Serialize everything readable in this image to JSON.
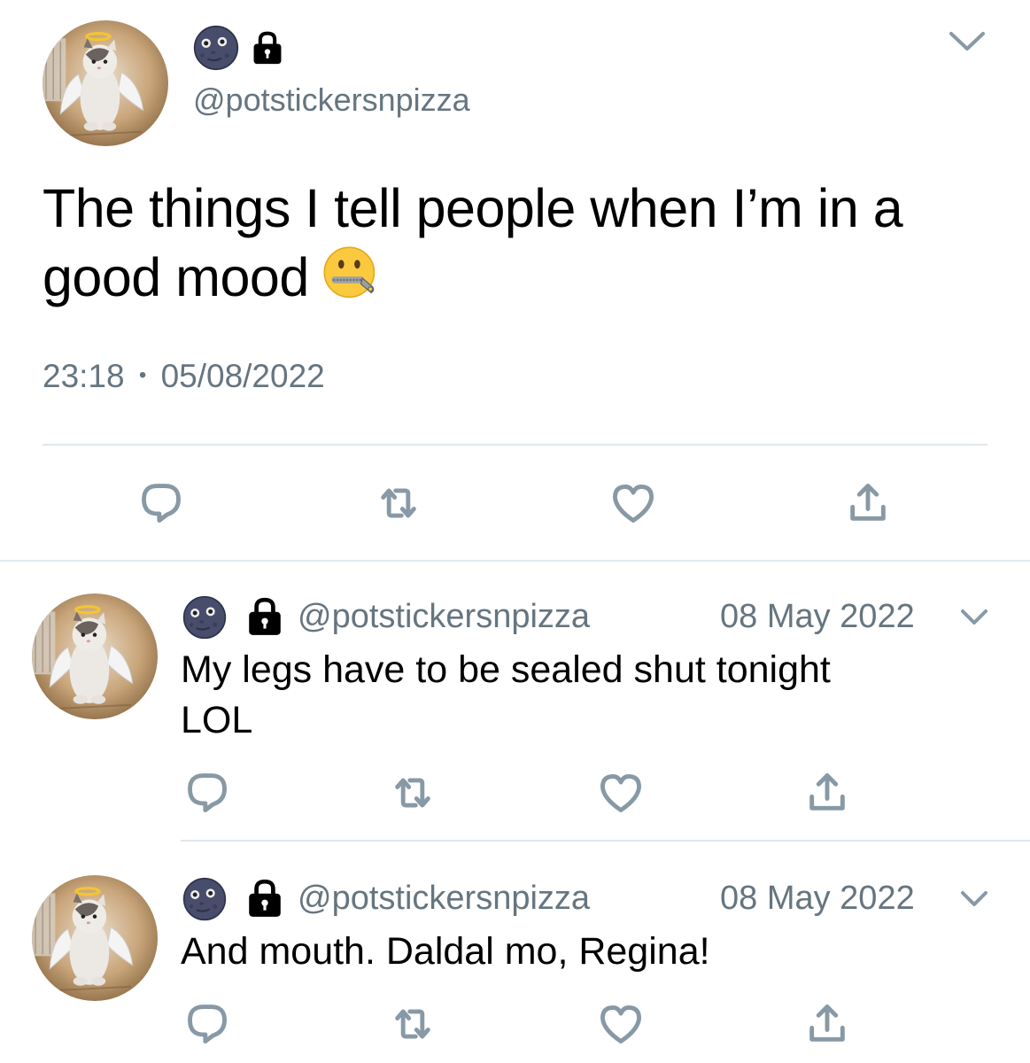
{
  "main_tweet": {
    "handle": "@potstickersnpizza",
    "text": "The things I tell people when I’m in a good mood",
    "emoji": "zipper-mouth-face",
    "time": "23:18",
    "separator": "•",
    "date": "05/08/2022"
  },
  "replies": [
    {
      "handle": "@potstickersnpizza",
      "date": "08 May 2022",
      "text_line1": "My legs have to be sealed shut tonight",
      "text_line2": "LOL"
    },
    {
      "handle": "@potstickersnpizza",
      "date": "08 May 2022",
      "text_line1": "And mouth. Daldal mo, Regina!"
    }
  ],
  "icons": {
    "name_emoji": "new-moon-face-icon",
    "protected": "lock-icon",
    "menu": "chevron-down-icon",
    "actions": [
      "reply-icon",
      "retweet-icon",
      "like-icon",
      "share-icon"
    ]
  },
  "colors": {
    "secondary_text": "#66757f",
    "icon_gray": "#8899a6",
    "divider": "#e1e8ed"
  }
}
